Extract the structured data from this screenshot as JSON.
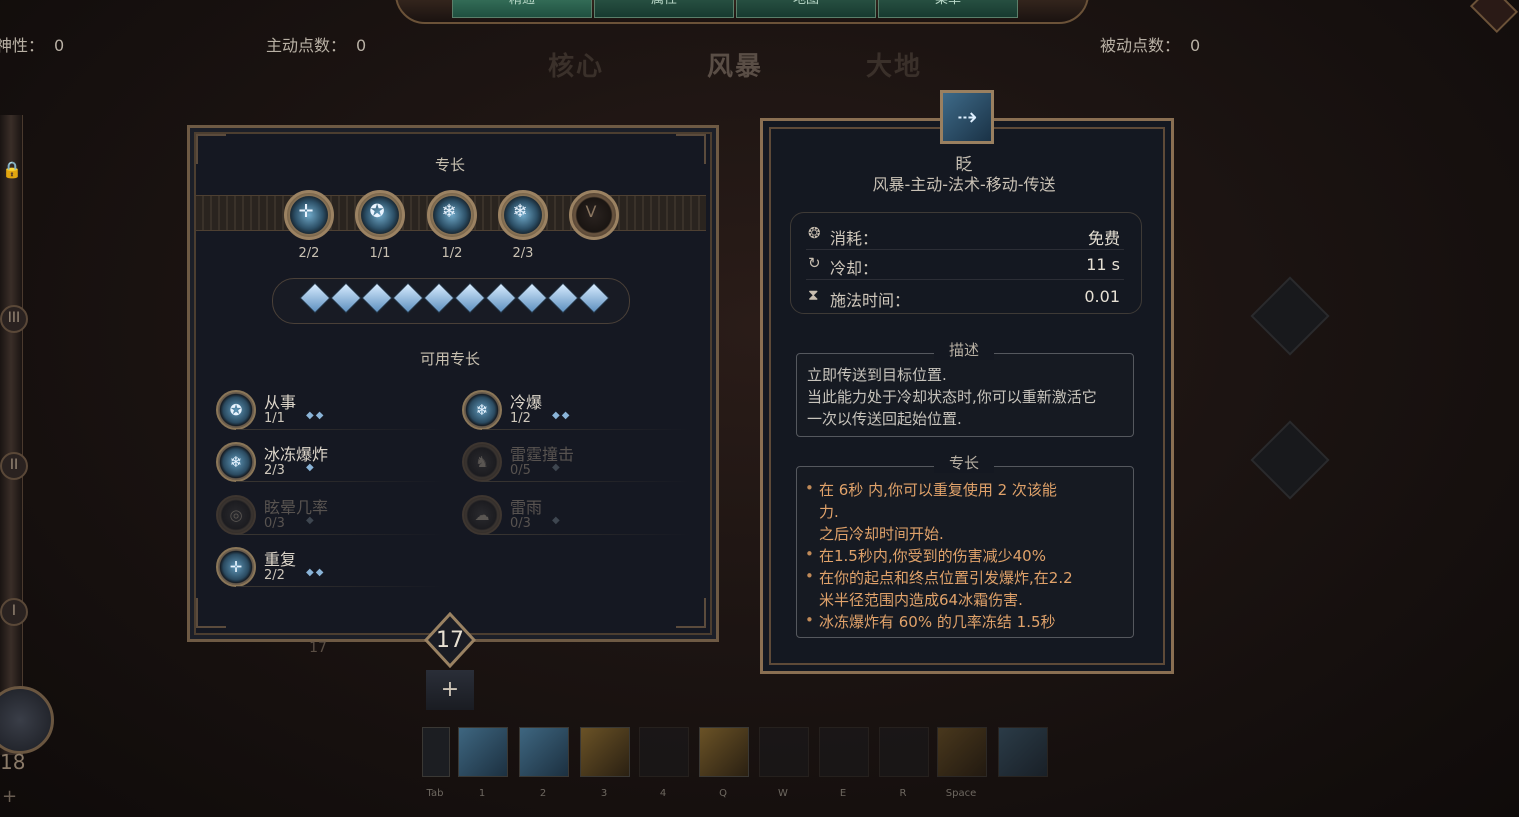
{
  "top_tabs": [
    "精通",
    "属性",
    "地图",
    "菜单"
  ],
  "stats": {
    "left_label": "神性：",
    "left_value": "0",
    "active_label": "主动点数：",
    "active_value": "0",
    "passive_label": "被动点数：",
    "passive_value": "0"
  },
  "trees": [
    "核心",
    "风暴",
    "大地"
  ],
  "left_bar": {
    "roman": [
      "III",
      "II",
      "I"
    ],
    "level": "18",
    "plus": "+"
  },
  "specialization": {
    "title": "专长",
    "nodes": [
      {
        "icon": "clock-rune-icon",
        "glyph": "✛",
        "count": "2/2"
      },
      {
        "icon": "rune-icon",
        "glyph": "✪",
        "count": "1/1"
      },
      {
        "icon": "snowflake-icon",
        "glyph": "❄",
        "count": "1/2"
      },
      {
        "icon": "snowflake-icon",
        "glyph": "❄",
        "count": "2/3"
      },
      {
        "icon": "locked-v-icon",
        "glyph": "V",
        "count": ""
      }
    ],
    "gems_count": 10,
    "available_title": "可用专长",
    "skills_left": [
      {
        "name": "从事",
        "count": "1/1",
        "diamonds": "◆◆",
        "dim": false,
        "glyph": "✪"
      },
      {
        "name": "冰冻爆炸",
        "count": "2/3",
        "diamonds": "◆",
        "dim": false,
        "glyph": "❄"
      },
      {
        "name": "眩晕几率",
        "count": "0/3",
        "diamonds": "◆",
        "dim": true,
        "glyph": "◎"
      },
      {
        "name": "重复",
        "count": "2/2",
        "diamonds": "◆◆",
        "dim": false,
        "glyph": "✛"
      }
    ],
    "skills_right": [
      {
        "name": "冷爆",
        "count": "1/2",
        "diamonds": "◆◆",
        "dim": false,
        "glyph": "❄"
      },
      {
        "name": "雷霆撞击",
        "count": "0/5",
        "diamonds": "◆",
        "dim": true,
        "glyph": "♞"
      },
      {
        "name": "雷雨",
        "count": "0/3",
        "diamonds": "◆",
        "dim": true,
        "glyph": "☁"
      }
    ],
    "level": "17",
    "small_level": "17",
    "add": "+"
  },
  "ability": {
    "name": "眨",
    "tags": "风暴-主动-法术-移动-传送",
    "stats": [
      {
        "icon": "mana-icon",
        "glyph": "❂",
        "label": "消耗：",
        "value": "免费"
      },
      {
        "icon": "cooldown-icon",
        "glyph": "↻",
        "label": "冷却：",
        "value": "11 s"
      },
      {
        "icon": "hourglass-icon",
        "glyph": "⧗",
        "label": "施法时间：",
        "value": "0.01"
      }
    ],
    "desc_title": "描述",
    "desc_lines": [
      "立即传送到目标位置.",
      "当此能力处于冷却状态时,你可以重新激活它",
      "一次以传送回起始位置."
    ],
    "spec_title": "专长",
    "spec_lines": [
      {
        "bullet": "•",
        "text": "在 6秒 内,你可以重复使用 2 次该能"
      },
      {
        "bullet": "",
        "text": "力."
      },
      {
        "bullet": "",
        "text": "之后冷却时间开始."
      },
      {
        "bullet": "•",
        "text": "在1.5秒内,你受到的伤害减少40%"
      },
      {
        "bullet": "•",
        "text": "在你的起点和终点位置引发爆炸,在2.2"
      },
      {
        "bullet": "",
        "text": "米半径范围内造成64冰霜伤害."
      },
      {
        "bullet": "•",
        "text": "冰冻爆炸有 60% 的几率冻结 1.5秒"
      }
    ]
  },
  "hotbar": [
    {
      "key": "Tab",
      "icon": "tab-icon",
      "style": ""
    },
    {
      "key": "1",
      "icon": "blink-skill-icon",
      "style": "filled"
    },
    {
      "key": "2",
      "icon": "ice-shards-icon",
      "style": "filled"
    },
    {
      "key": "3",
      "icon": "staff-icon",
      "style": "yellow"
    },
    {
      "key": "4",
      "icon": "empty-slot-icon",
      "style": ""
    },
    {
      "key": "Q",
      "icon": "ring-icon",
      "style": "yellow"
    },
    {
      "key": "W",
      "icon": "empty-slot-icon",
      "style": ""
    },
    {
      "key": "E",
      "icon": "empty-slot-icon",
      "style": ""
    },
    {
      "key": "R",
      "icon": "empty-slot-icon",
      "style": ""
    },
    {
      "key": "Space",
      "icon": "dash-skill-icon",
      "style": "yellow"
    },
    {
      "key": "",
      "icon": "potion-icon",
      "style": "filled"
    }
  ]
}
